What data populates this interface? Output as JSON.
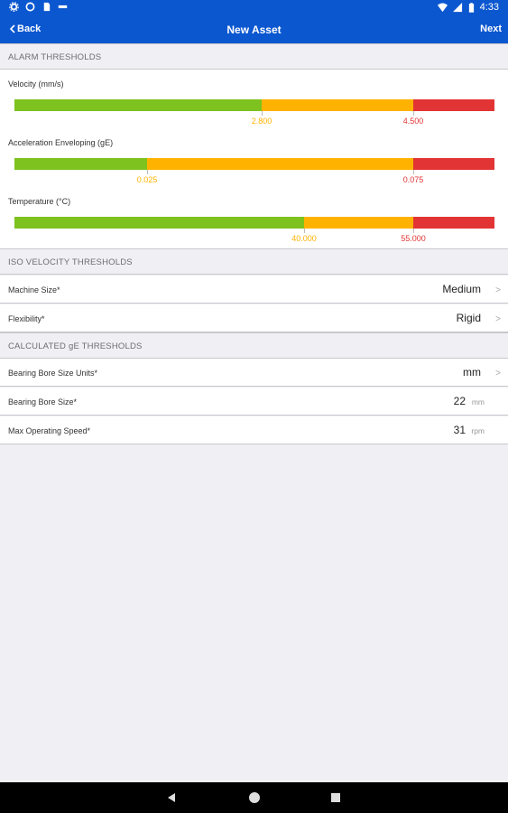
{
  "status_bar": {
    "time": "4:33",
    "icons": [
      "settings-icon",
      "sync-icon",
      "sim-icon",
      "notification-icon",
      "wifi-icon",
      "cell-signal-icon",
      "battery-icon"
    ]
  },
  "nav": {
    "back_label": "Back",
    "title": "New Asset",
    "next_label": "Next"
  },
  "alarm_thresholds": {
    "header": "ALARM THRESHOLDS",
    "items": [
      {
        "label": "Velocity (mm/s)",
        "warn_value": "2.800",
        "alarm_value": "4.500",
        "warn_fraction": 0.515,
        "alarm_fraction": 0.83
      },
      {
        "label": "Acceleration Enveloping (gE)",
        "warn_value": "0.025",
        "alarm_value": "0.075",
        "warn_fraction": 0.277,
        "alarm_fraction": 0.83
      },
      {
        "label": "Temperature (°C)",
        "warn_value": "40.000",
        "alarm_value": "55.000",
        "warn_fraction": 0.603,
        "alarm_fraction": 0.83
      }
    ]
  },
  "iso_velocity": {
    "header": "ISO VELOCITY THRESHOLDS",
    "machine_size_label": "Machine Size*",
    "machine_size_value": "Medium",
    "flexibility_label": "Flexibility*",
    "flexibility_value": "Rigid"
  },
  "calculated_ge": {
    "header": "CALCULATED gE THRESHOLDS",
    "bore_units_label": "Bearing Bore Size Units*",
    "bore_units_value": "mm",
    "bore_size_label": "Bearing Bore Size*",
    "bore_size_value": "22",
    "bore_size_unit": "mm",
    "speed_label": "Max Operating Speed*",
    "speed_value": "31",
    "speed_unit": "rpm"
  },
  "chevron": ">",
  "colors": {
    "primary": "#0b57d0",
    "good": "#7dc21e",
    "warning": "#ffb300",
    "alarm": "#e23434"
  }
}
